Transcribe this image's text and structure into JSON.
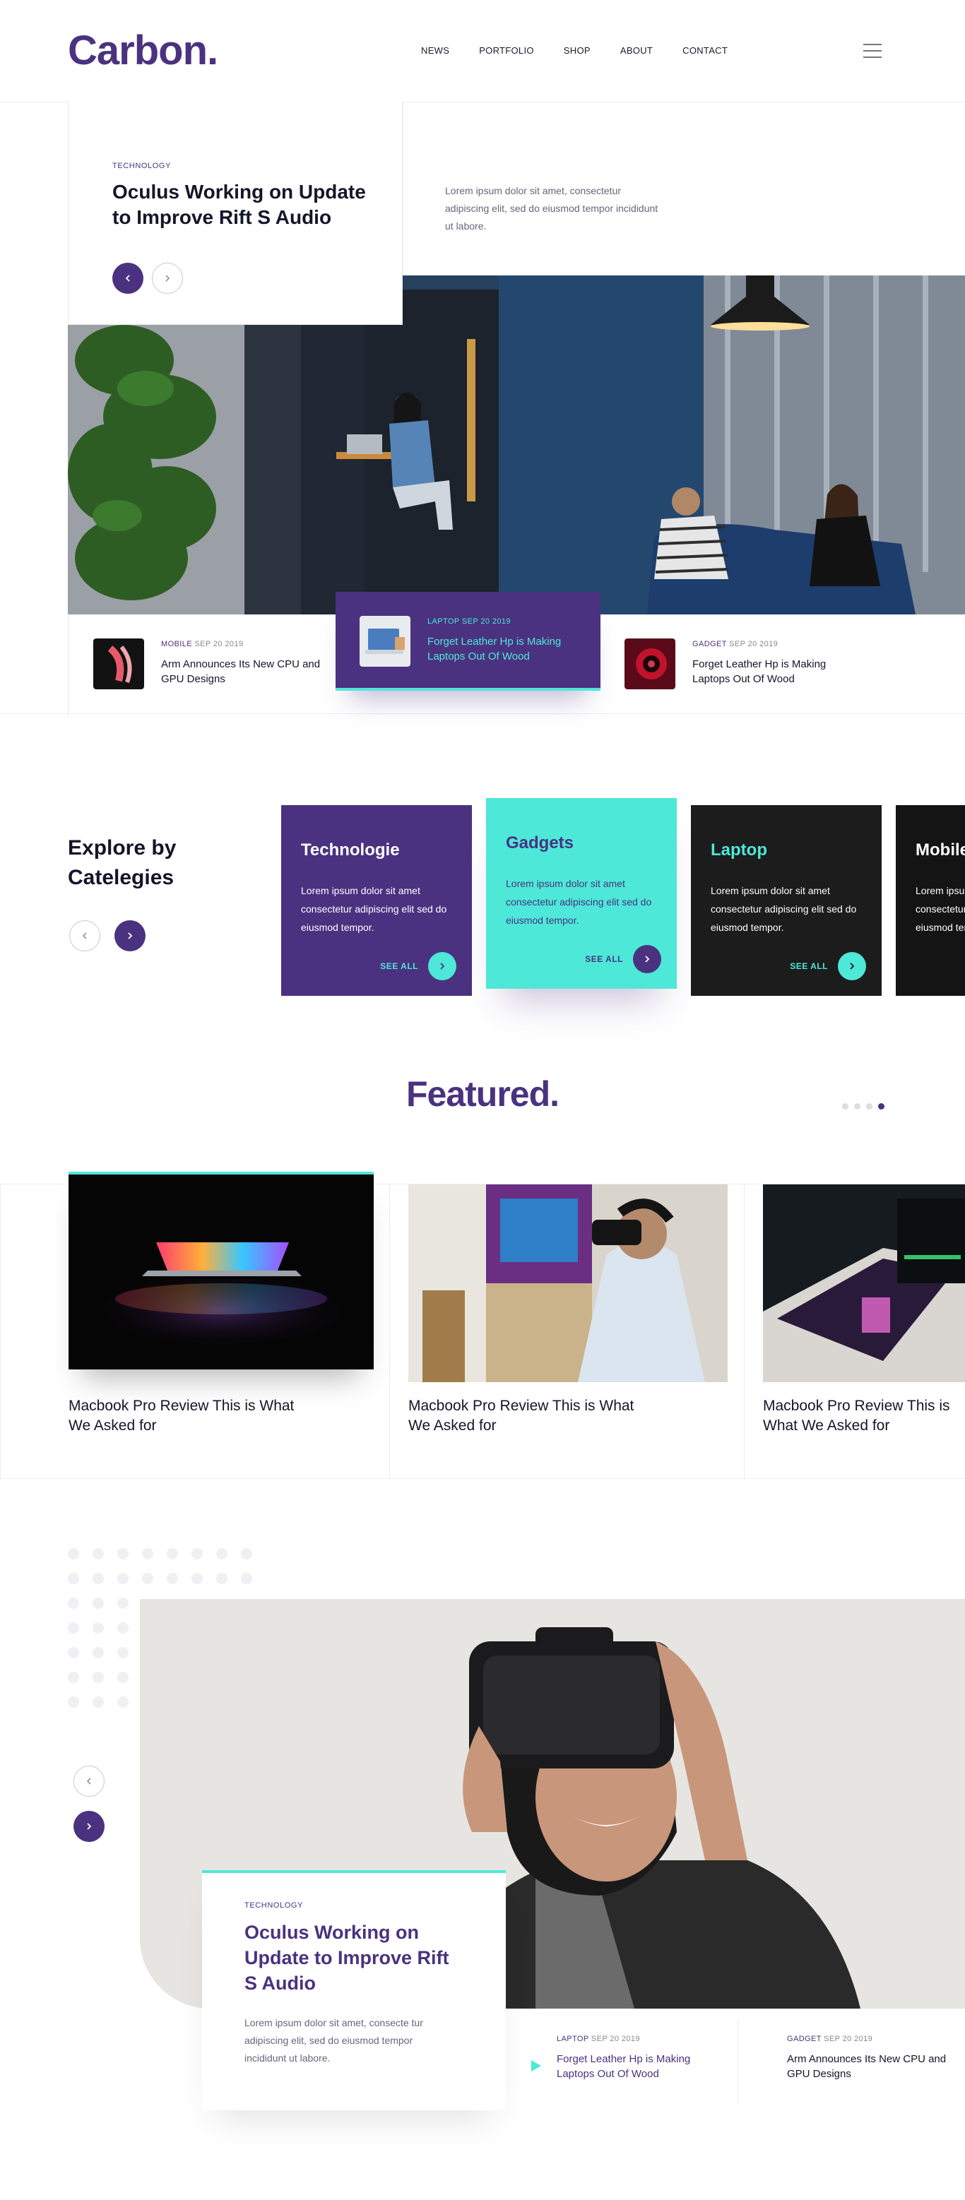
{
  "header": {
    "logo": "Carbon.",
    "nav": [
      "NEWS",
      "PORTFOLIO",
      "SHOP",
      "ABOUT",
      "CONTACT"
    ]
  },
  "hero": {
    "tag": "TECHNOLOGY",
    "title": "Oculus Working on Update to Improve Rift S Audio",
    "description": "Lorem ipsum dolor sit amet, consectetur adipiscing elit, sed do eiusmod tempor incididunt ut labore.",
    "prev_icon": "chevron-left-icon",
    "next_icon": "chevron-right-icon"
  },
  "news_strip": [
    {
      "category": "MOBILE",
      "date": "SEP 20 2019",
      "title": "Arm Announces Its New CPU and GPU Designs"
    },
    {
      "category": "LAPTOP",
      "date": "SEP 20 2019",
      "title": "Forget Leather Hp is Making Laptops Out Of Wood"
    },
    {
      "category": "GADGET",
      "date": "SEP 20 2019",
      "title": "Forget Leather Hp is Making Laptops Out Of Wood"
    }
  ],
  "categories": {
    "heading": "Explore by Catelegies",
    "see_all": "SEE ALL",
    "items": [
      {
        "name": "Technologie",
        "text": "Lorem ipsum dolor sit amet consectetur adipiscing elit sed do eiusmod tempor."
      },
      {
        "name": "Gadgets",
        "text": "Lorem ipsum dolor sit amet consectetur adipiscing elit sed do eiusmod tempor."
      },
      {
        "name": "Laptop",
        "text": "Lorem ipsum dolor sit amet consectetur adipiscing elit sed do eiusmod tempor."
      },
      {
        "name": "Mobile",
        "text": "Lorem ipsum dolor sit amet consectetur adipiscing elit sed do eiusmod tempor."
      }
    ]
  },
  "featured": {
    "title": "Featured.",
    "items": [
      {
        "caption": "Macbook Pro Review This is What We Asked for"
      },
      {
        "caption": "Macbook Pro Review This is What We Asked for"
      },
      {
        "caption": "Macbook Pro Review This is What We Asked for"
      }
    ]
  },
  "spotlight": {
    "tag": "TECHNOLOGY",
    "title": "Oculus Working on Update to Improve Rift S Audio",
    "description": "Lorem ipsum dolor sit amet, consecte tur adipiscing elit, sed do eiusmod tempor incididunt ut labore.",
    "news": [
      {
        "category": "LAPTOP",
        "date": "SEP 20 2019",
        "title": "Forget Leather Hp is Making Laptops Out Of Wood"
      },
      {
        "category": "GADGET",
        "date": "SEP 20 2019",
        "title": "Arm Announces Its New CPU and GPU Designs"
      }
    ]
  },
  "colors": {
    "accent": "#4a3280",
    "teal": "#4de8d8",
    "dark": "#1c1c1c"
  }
}
